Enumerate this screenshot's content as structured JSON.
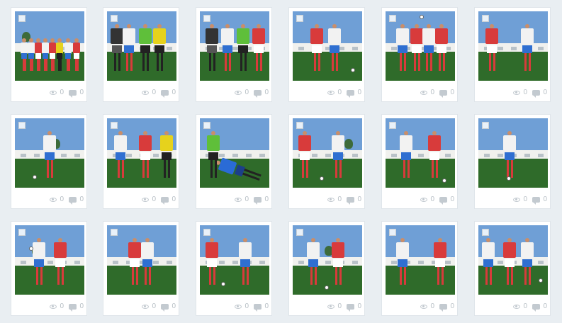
{
  "colors": {
    "background": "#e9eef2",
    "card": "#ffffff",
    "stat_text": "#b8c0c6",
    "sky": "#6f9fd6",
    "grass": "#2f6b2a",
    "team_red": "#d83b3b",
    "team_white": "#f2f2f2",
    "keeper_green": "#5fbf3a",
    "referee_yellow": "#e6d21c"
  },
  "icons": {
    "views": "eye-icon",
    "comments": "comment-icon",
    "select": "checkbox-icon"
  },
  "photos": [
    {
      "subject": "team lineup",
      "views": "0",
      "comments": "0"
    },
    {
      "subject": "players with referees",
      "views": "0",
      "comments": "0"
    },
    {
      "subject": "referees and captains",
      "views": "0",
      "comments": "0"
    },
    {
      "subject": "players challenge",
      "views": "0",
      "comments": "0"
    },
    {
      "subject": "header duel",
      "views": "0",
      "comments": "0"
    },
    {
      "subject": "players running",
      "views": "0",
      "comments": "0"
    },
    {
      "subject": "player dribbling",
      "views": "0",
      "comments": "0"
    },
    {
      "subject": "players with linesman",
      "views": "0",
      "comments": "0"
    },
    {
      "subject": "goalkeeper dive",
      "views": "0",
      "comments": "0"
    },
    {
      "subject": "players chasing",
      "views": "0",
      "comments": "0"
    },
    {
      "subject": "tackle",
      "views": "0",
      "comments": "0"
    },
    {
      "subject": "player running",
      "views": "0",
      "comments": "0"
    },
    {
      "subject": "players contest",
      "views": "0",
      "comments": "0"
    },
    {
      "subject": "players shoulder to shoulder",
      "views": "0",
      "comments": "0"
    },
    {
      "subject": "players sprint",
      "views": "0",
      "comments": "0"
    },
    {
      "subject": "player kicking",
      "views": "0",
      "comments": "0"
    },
    {
      "subject": "players running ball",
      "views": "0",
      "comments": "0"
    },
    {
      "subject": "players group",
      "views": "0",
      "comments": "0"
    }
  ]
}
